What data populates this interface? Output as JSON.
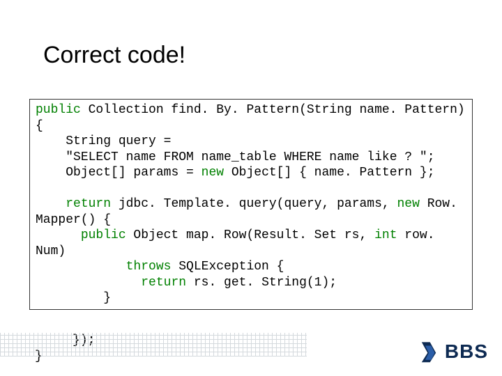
{
  "title": "Correct code!",
  "code": {
    "l1a": "public",
    "l1b": " Collection find. By. Pattern(String name. Pattern) {",
    "l2": "    String query =",
    "l3": "    \"SELECT name FROM name_table WHERE name like ? \";",
    "l4a": "    Object[] params = ",
    "l4b": "new",
    "l4c": " Object[] { name. Pattern };",
    "blank": "",
    "l5a": "    ",
    "l5b": "return",
    "l5c": " jdbc. Template. query(query, params, ",
    "l5d": "new",
    "l5e": " Row. Mapper() {",
    "l6a": "      ",
    "l6b": "public",
    "l6c": " Object map. Row(Result. Set rs, ",
    "l6d": "int",
    "l6e": " row. Num)",
    "l7a": "            ",
    "l7b": "throws",
    "l7c": " SQLException {",
    "l8a": "              ",
    "l8b": "return",
    "l8c": " rs. get. String(1);",
    "l9": "         }",
    "l10": "     });",
    "l11": "}"
  },
  "logo": {
    "text": "BBS"
  }
}
